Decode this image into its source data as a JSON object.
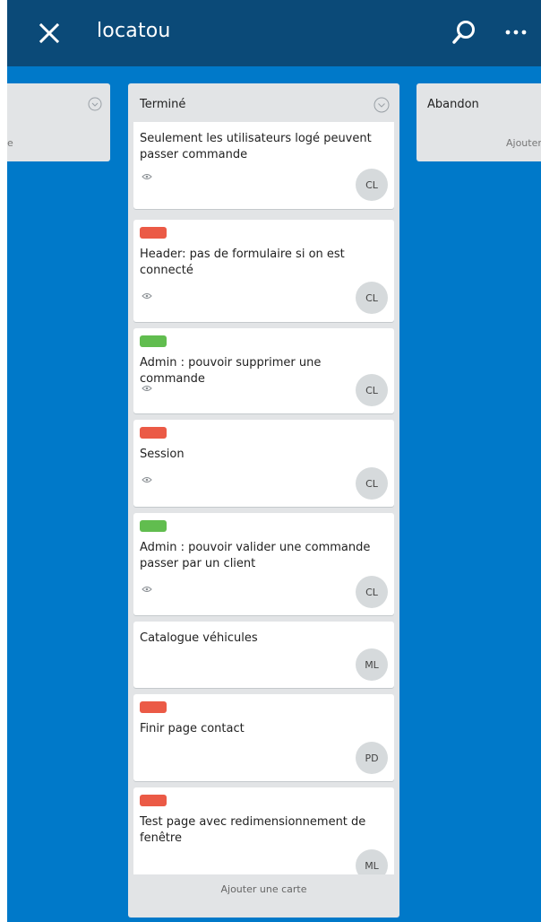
{
  "topbar": {
    "board_name": "locatou",
    "close_icon": "close-icon",
    "search_icon": "search-icon",
    "more_icon": "more-icon"
  },
  "lists": {
    "left": {
      "add_partial": "e"
    },
    "main": {
      "title": "Terminé",
      "add_card": "Ajouter une carte",
      "cards": [
        {
          "text": "Seulement les utilisateurs logé peuvent passer commande",
          "label_color": "#eb5a46",
          "watched": true,
          "member": "CL"
        },
        {
          "text": "Header: pas de formulaire si on est connecté",
          "label_color": "#eb5a46",
          "watched": true,
          "member": "CL"
        },
        {
          "text": "Admin : pouvoir supprimer une commande",
          "label_color": "#61bd4f",
          "watched": true,
          "member": "CL"
        },
        {
          "text": "Session",
          "label_color": "#eb5a46",
          "watched": true,
          "member": "CL"
        },
        {
          "text": "Admin : pouvoir valider une commande passer par un client",
          "label_color": "#61bd4f",
          "watched": true,
          "member": "CL"
        },
        {
          "text": "Catalogue véhicules",
          "label_color": null,
          "watched": false,
          "member": "ML"
        },
        {
          "text": "Finir page contact",
          "label_color": "#eb5a46",
          "watched": false,
          "member": "PD"
        },
        {
          "text": "Test page avec redimensionnement de fenêtre",
          "label_color": "#eb5a46",
          "watched": false,
          "member": "ML"
        }
      ]
    },
    "right": {
      "title": "Abandon",
      "add_partial": "Ajouter"
    }
  }
}
